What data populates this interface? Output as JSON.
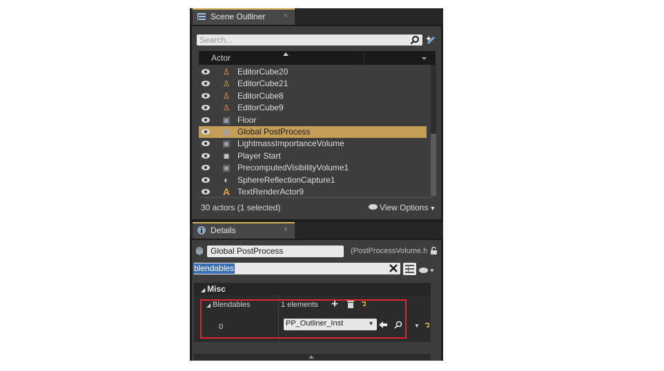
{
  "outliner": {
    "tab_label": "Scene Outliner",
    "tab_close": "×",
    "search_placeholder": "Search...",
    "column_header": "Actor",
    "actors": [
      {
        "name": "EditorCube20",
        "icon": "actor-blueprint-icon",
        "selected": false
      },
      {
        "name": "EditorCube21",
        "icon": "actor-blueprint-icon",
        "selected": false
      },
      {
        "name": "EditorCube8",
        "icon": "actor-blueprint-icon",
        "selected": false
      },
      {
        "name": "EditorCube9",
        "icon": "actor-blueprint-icon",
        "selected": false
      },
      {
        "name": "Floor",
        "icon": "static-mesh-icon",
        "selected": false
      },
      {
        "name": "Global PostProcess",
        "icon": "postprocess-volume-icon",
        "selected": true
      },
      {
        "name": "LightmassImportanceVolume",
        "icon": "volume-icon",
        "selected": false
      },
      {
        "name": "Player Start",
        "icon": "gamepad-icon",
        "selected": false
      },
      {
        "name": "PrecomputedVisibilityVolume1",
        "icon": "volume-icon",
        "selected": false
      },
      {
        "name": "SphereReflectionCapture1",
        "icon": "reflection-capture-icon",
        "selected": false
      },
      {
        "name": "TextRenderActor9",
        "icon": "text-render-icon",
        "selected": false
      }
    ],
    "actor_count": "30 actors (1 selected)",
    "view_options": "View Options"
  },
  "details": {
    "tab_label": "Details",
    "tab_close": "×",
    "object_name": "Global PostProcess",
    "class_name": "(PostProcessVolume.h",
    "filter_text": "blendables",
    "category": "Misc",
    "blendables_label": "Blendables",
    "elements_label": "1 elements",
    "index_label": "0",
    "asset_value": "PP_Outliner_Inst"
  },
  "colors": {
    "selection": "#c49d57",
    "tab_accent": "#d9b057",
    "highlight_box": "#e0262e"
  }
}
